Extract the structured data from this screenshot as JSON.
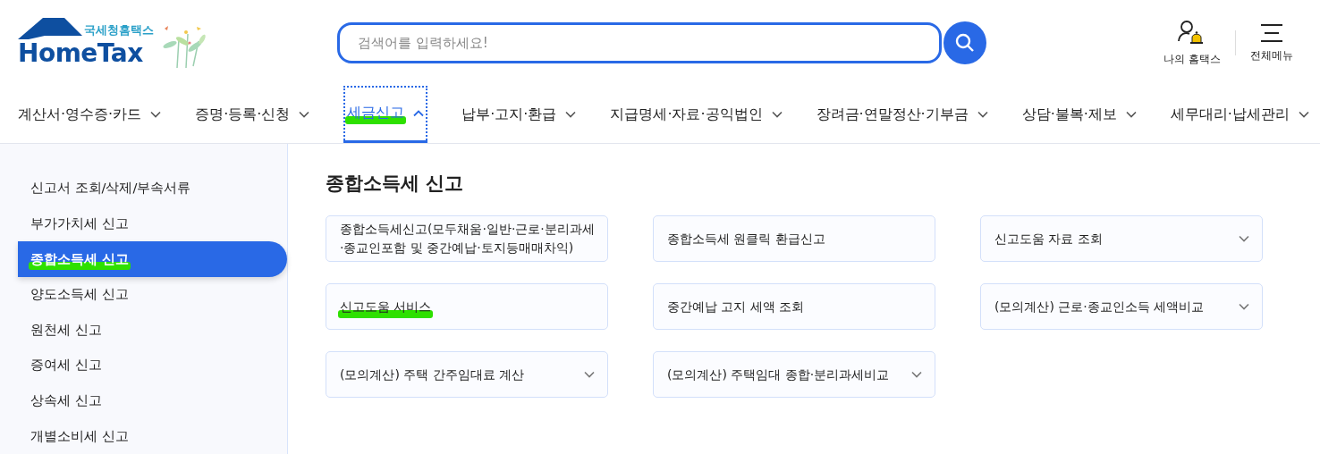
{
  "logo": {
    "subtitle": "국세청홈택스",
    "title": "HomeTax"
  },
  "search": {
    "placeholder": "검색어를 입력하세요!"
  },
  "header_links": [
    {
      "kind": "user",
      "label": "나의 홈택스"
    },
    {
      "kind": "menu",
      "label": "전체메뉴"
    }
  ],
  "nav": [
    {
      "label": "계산서·영수증·카드",
      "selected": false,
      "expanded": false,
      "highlighted": false
    },
    {
      "label": "증명·등록·신청",
      "selected": false,
      "expanded": false,
      "highlighted": false
    },
    {
      "label": "세금신고",
      "selected": true,
      "expanded": true,
      "highlighted": true
    },
    {
      "label": "납부·고지·환급",
      "selected": false,
      "expanded": false,
      "highlighted": false
    },
    {
      "label": "지급명세·자료·공익법인",
      "selected": false,
      "expanded": false,
      "highlighted": false
    },
    {
      "label": "장려금·연말정산·기부금",
      "selected": false,
      "expanded": false,
      "highlighted": false
    },
    {
      "label": "상담·불복·제보",
      "selected": false,
      "expanded": false,
      "highlighted": false
    },
    {
      "label": "세무대리·납세관리",
      "selected": false,
      "expanded": false,
      "highlighted": false
    }
  ],
  "sidebar": {
    "items": [
      {
        "label": "신고서 조회/삭제/부속서류",
        "selected": false,
        "highlighted": false
      },
      {
        "label": "부가가치세 신고",
        "selected": false,
        "highlighted": false
      },
      {
        "label": "종합소득세 신고",
        "selected": true,
        "highlighted": true
      },
      {
        "label": "양도소득세 신고",
        "selected": false,
        "highlighted": false
      },
      {
        "label": "원천세 신고",
        "selected": false,
        "highlighted": false
      },
      {
        "label": "증여세 신고",
        "selected": false,
        "highlighted": false
      },
      {
        "label": "상속세 신고",
        "selected": false,
        "highlighted": false
      },
      {
        "label": "개별소비세 신고",
        "selected": false,
        "highlighted": false
      }
    ]
  },
  "content": {
    "title": "종합소득세 신고",
    "cards": [
      {
        "kind": "link",
        "label": "종합소득세신고(모두채움·일반·근로·분리과세·종교인포함 및 중간예납·토지등매매차익)",
        "highlighted": false
      },
      {
        "kind": "link",
        "label": "종합소득세 원클릭 환급신고",
        "highlighted": false
      },
      {
        "kind": "dropdown",
        "label": "신고도움 자료 조회",
        "highlighted": false
      },
      {
        "kind": "link",
        "label": "신고도움 서비스",
        "highlighted": true
      },
      {
        "kind": "link",
        "label": "중간예납 고지 세액 조회",
        "highlighted": false
      },
      {
        "kind": "dropdown",
        "label": "(모의계산) 근로·종교인소득 세액비교",
        "highlighted": false
      },
      {
        "kind": "dropdown",
        "label": "(모의계산) 주택 간주임대료 계산",
        "highlighted": false
      },
      {
        "kind": "dropdown",
        "label": "(모의계산) 주택임대 종합·분리과세비교",
        "highlighted": false
      }
    ]
  }
}
